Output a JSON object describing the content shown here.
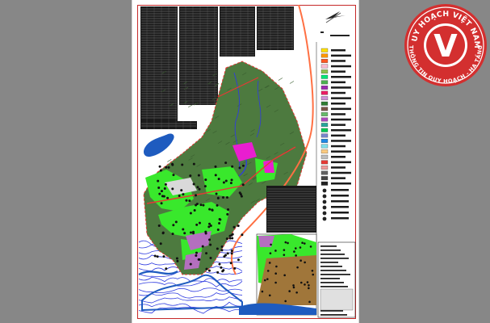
{
  "logo": {
    "letter": "V",
    "top_text": "QUY HOẠCH VIỆT NAM",
    "bottom_text": "THÔNG TIN QUY HOẠCH - HẠ TẦNG",
    "colors": {
      "red": "#d32f2f",
      "ring": "#ffffff",
      "text": "#ffffff"
    }
  },
  "map": {
    "colors": {
      "background": "#878787",
      "sheet": "#ffffff",
      "frame": "#c62828",
      "forest": "#4d7a3f",
      "forest_dark": "#3a5e30",
      "green_space": "#39e82c",
      "residential": "#b46fbf",
      "magenta_zone": "#e91ed0",
      "water": "#1e5bbf",
      "river_line": "#2f3be0",
      "road_red": "#e53935",
      "road_orange": "#ff7043",
      "table_fill": "#1a1a1a",
      "inset_brown": "#a0763a"
    },
    "legend_swatch_colors": [
      "#ffe000",
      "#ff9800",
      "#ff5722",
      "#f8bbd0",
      "#8bc34a",
      "#00e676",
      "#4caf50",
      "#9c27b0",
      "#e91e63",
      "#ce93d8",
      "#2e7d32",
      "#795548",
      "#66bb6a",
      "#ab47bc",
      "#26a69a",
      "#00c853",
      "#7986cb",
      "#1e88e5",
      "#80deea",
      "#ffcc80",
      "#bdbdbd",
      "#e53935",
      "#ef9a9a",
      "#616161",
      "#424242",
      "#212121"
    ]
  }
}
